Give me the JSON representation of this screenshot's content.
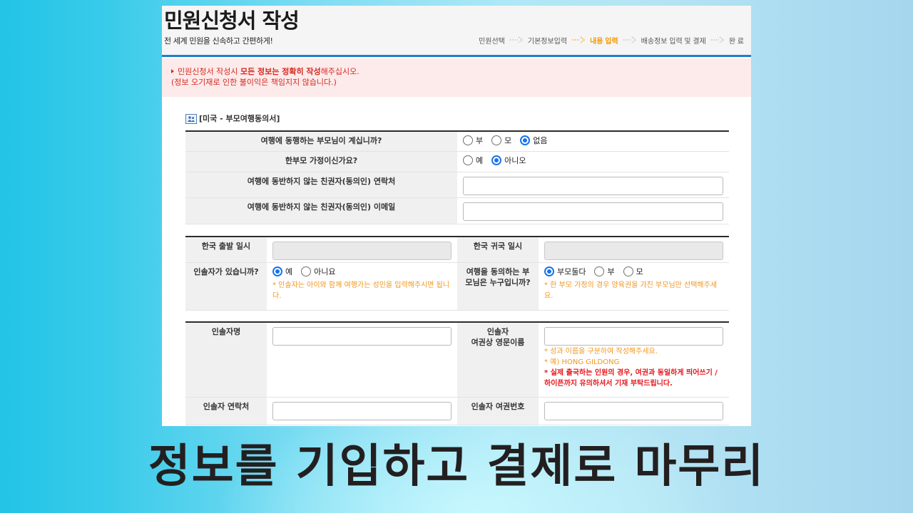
{
  "header": {
    "title": "민원신청서 작성",
    "subtitle": "전 세계 민원을 신속하고 간편하게!",
    "steps": [
      "민원선택",
      "기본정보입력",
      "내용 입력",
      "배송정보 입력 및 결제",
      "완 료"
    ],
    "active_step_index": 2
  },
  "notice": {
    "line1": {
      "pre": "민원신청서 작성시 ",
      "bold": "모든 정보는 정확히 작성",
      "post": "해주십시오."
    },
    "line2": "(정보 오기재로 인한 불이익은 책임지지 않습니다.)"
  },
  "section_title": "[미국 - 부모여행동의서]",
  "consent_table": {
    "accompanying_parent": {
      "label": "여행에 동행하는 부모님이 계십니까?",
      "options": [
        "부",
        "모",
        "없음"
      ],
      "selected": "없음"
    },
    "single_parent": {
      "label": "한부모 가정이신가요?",
      "options": [
        "예",
        "아니오"
      ],
      "selected": "아니오"
    },
    "guardian_phone": {
      "label": "여행에 동반하지 않는 친권자(동의인) 연락처",
      "value": ""
    },
    "guardian_email": {
      "label": "여행에 동반하지 않는 친권자(동의인) 이메일",
      "value": ""
    }
  },
  "travel_table": {
    "departure": {
      "label": "한국 출발 일시",
      "value": ""
    },
    "return": {
      "label": "한국 귀국 일시",
      "value": ""
    },
    "has_escort": {
      "label": "인솔자가 있습니까?",
      "options": [
        "예",
        "아니요"
      ],
      "selected": "예",
      "note": "* 인솔자는 아이와 함께 여행가는 성인을 입력해주시면 됩니다."
    },
    "consenting_parent": {
      "label": "여행을 동의하는 부모님은 누구입니까?",
      "options": [
        "부모둘다",
        "부",
        "모"
      ],
      "selected": "부모둘다",
      "note": "* 한 부모 가정의 경우 양육권을 가진 부모님만 선택해주세요."
    }
  },
  "escort_table": {
    "name": {
      "label": "인솔자명",
      "value": ""
    },
    "english_name": {
      "label_lines": [
        "인솔자",
        "여권상 영문이름"
      ],
      "value": "",
      "notes": [
        "* 성과 이름을 구분하여 작성해주세요.",
        "* 예) HONG GILDONG"
      ],
      "warning": "* 실제 출국하는 인원의 경우, 여권과 동일하게 띄어쓰기 / 하이픈까지 유의하셔서 기재 부탁드립니다."
    },
    "phone": {
      "label": "인솔자 연락처",
      "value": ""
    },
    "passport_no": {
      "label": "인솔자 여권번호",
      "value": ""
    }
  },
  "caption": "정보를 기입하고 결제로 마무리",
  "icons": {
    "step_arrow": "dotted-chevron-right",
    "notice_bullet": "triangle-right",
    "section": "people"
  },
  "colors": {
    "header_divider": "#1c80ca",
    "active_step": "#f39800",
    "notice_bg": "#fdeaea",
    "notice_text": "#d42a20",
    "note_orange": "#f0961e",
    "warning_red": "#e8141b",
    "radio_selected": "#1a73e8",
    "caption_text": "#231f20"
  }
}
